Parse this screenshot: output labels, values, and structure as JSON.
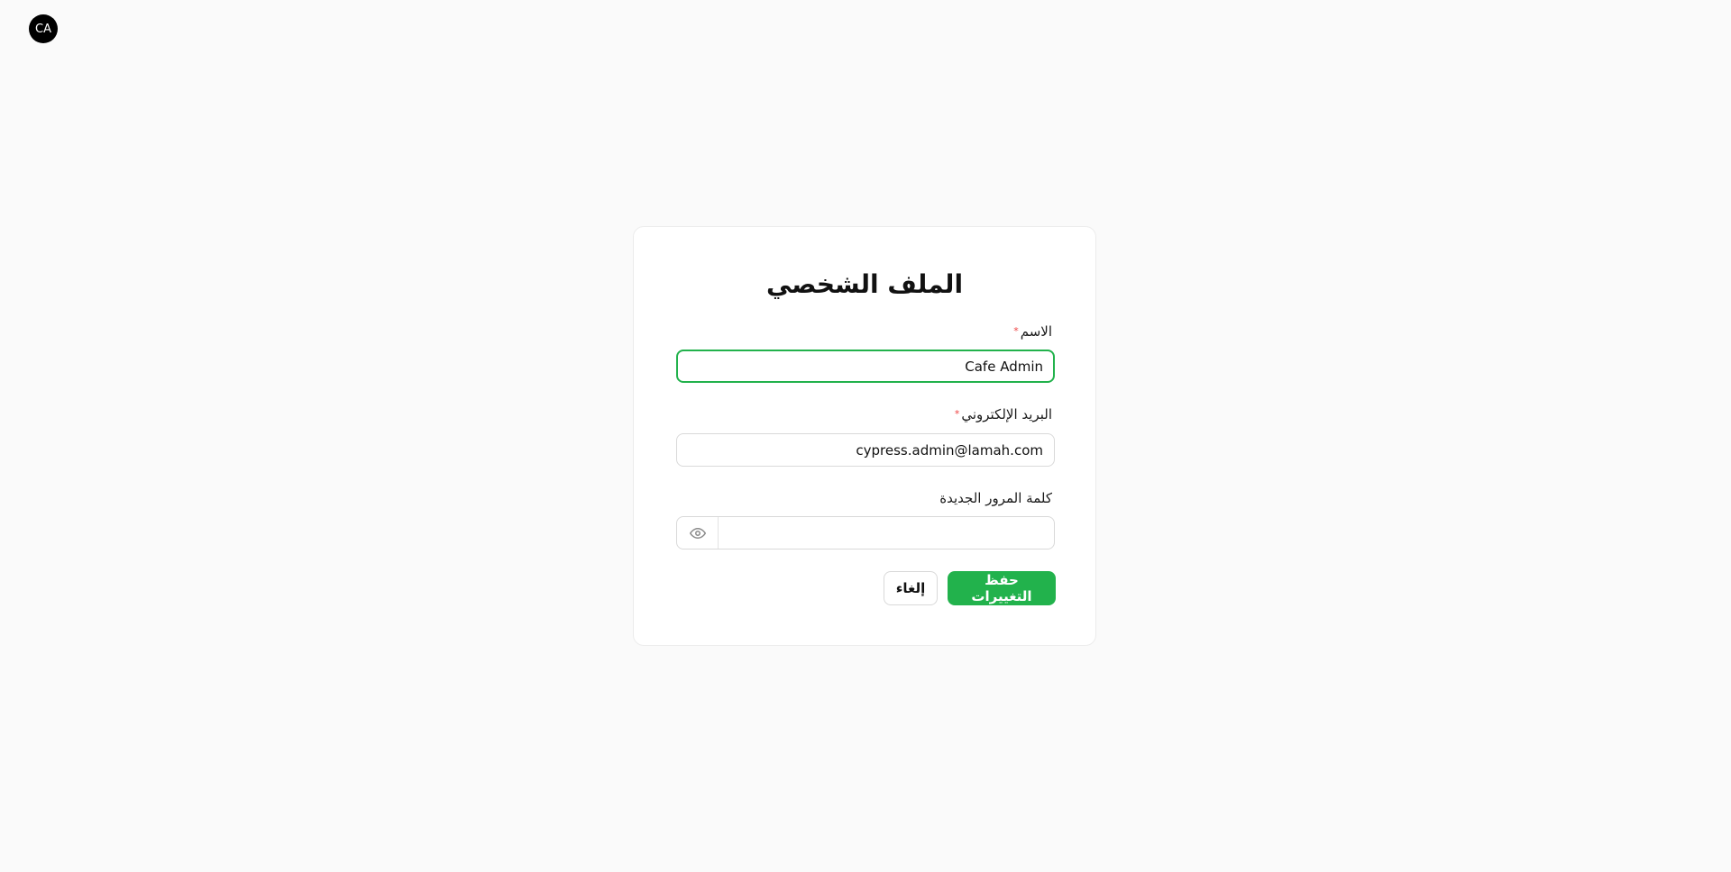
{
  "user": {
    "initials": "CA"
  },
  "profile": {
    "title": "الملف الشخصي",
    "name_field": {
      "label": "الاسم",
      "required_mark": "*",
      "value": "Cafe Admin"
    },
    "email_field": {
      "label": "البريد الإلكتروني",
      "required_mark": "*",
      "value": "cypress.admin@lamah.com"
    },
    "password_field": {
      "label": "كلمة المرور الجديدة",
      "value": "",
      "toggle_icon": "eye-icon"
    },
    "buttons": {
      "save_label": "حفظ التغييرات",
      "cancel_label": "إلغاء"
    }
  },
  "colors": {
    "accent": "#22b24c",
    "required": "#ef4444",
    "background": "#fafafa"
  }
}
